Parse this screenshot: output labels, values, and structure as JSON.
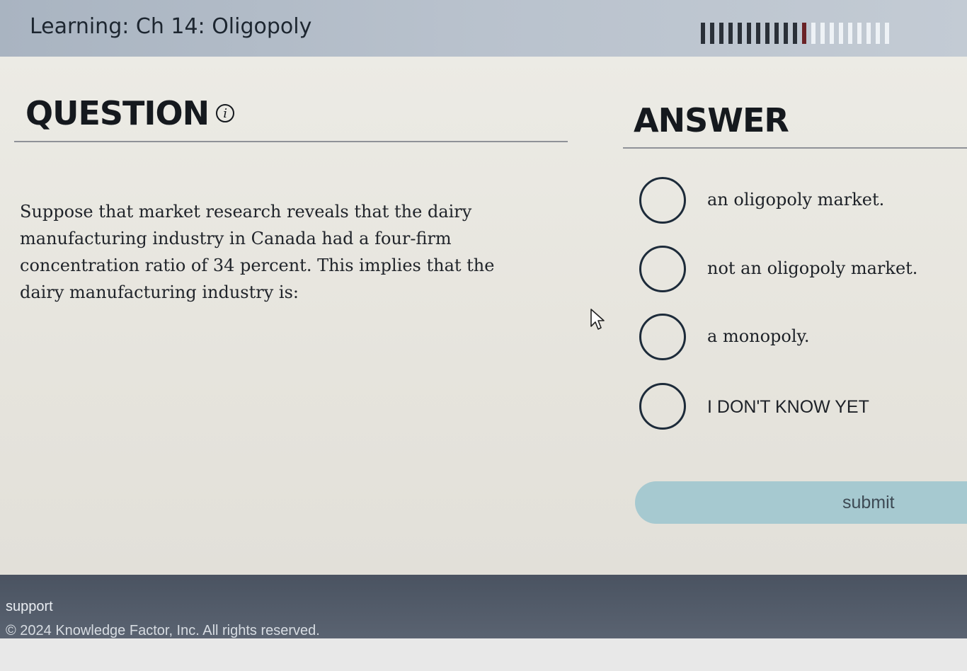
{
  "header": {
    "course_title": "Learning: Ch 14: Oligopoly",
    "progress": {
      "completed": 11,
      "current": 1,
      "remaining": 9
    }
  },
  "question": {
    "heading": "QUESTION",
    "info_icon": "info-icon",
    "text": "Suppose that market research reveals that the dairy manufacturing industry in Canada had a four-firm concentration ratio of 34 percent. This implies that the dairy manufacturing industry is:"
  },
  "answer": {
    "heading": "ANSWER",
    "options": [
      {
        "label": "an oligopoly market."
      },
      {
        "label": "not an oligopoly market."
      },
      {
        "label": "a monopoly."
      },
      {
        "label": "I DON'T KNOW YET"
      }
    ],
    "submit_label": "submit"
  },
  "footer": {
    "support_label": "support",
    "copyright": "© 2024 Knowledge Factor, Inc. All rights reserved."
  },
  "colors": {
    "header_bg": "#b9c2cd",
    "progress_done": "#2a3038",
    "progress_current": "#6a2226",
    "submit_bg": "#a6c9d0",
    "footer_bg": "#4a5361"
  }
}
